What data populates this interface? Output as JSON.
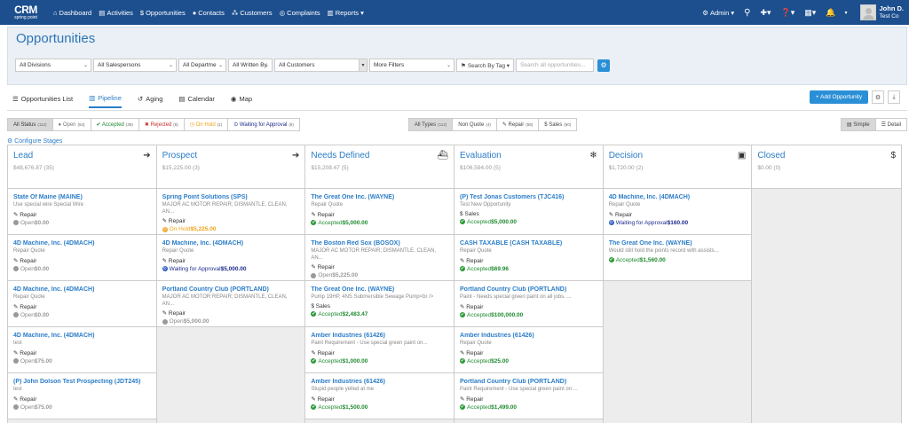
{
  "nav": {
    "logo_big": "CRM",
    "logo_small": "spring point",
    "items": [
      {
        "icon": "home-icon",
        "glyph": "⌂",
        "label": "Dashboard"
      },
      {
        "icon": "calendar-icon",
        "glyph": "▤",
        "label": "Activities"
      },
      {
        "icon": "dollar-icon",
        "glyph": "$",
        "label": "Opportunities"
      },
      {
        "icon": "user-icon",
        "glyph": "●",
        "label": "Contacts"
      },
      {
        "icon": "users-icon",
        "glyph": "⁂",
        "label": "Customers"
      },
      {
        "icon": "help-icon",
        "glyph": "◎",
        "label": "Complaints"
      },
      {
        "icon": "chart-icon",
        "glyph": "▥",
        "label": "Reports ▾"
      }
    ],
    "admin_label": "Admin ▾",
    "user_name": "John D.",
    "user_company": "Test Co"
  },
  "page": {
    "title": "Opportunities"
  },
  "filters": {
    "divisions": "All Divisions",
    "salespersons": "All Salespersons",
    "departments": "All Departme",
    "written_by": "All Written By",
    "customers": "All Customers",
    "more": "More Filters",
    "search_by_tag": "Search By Tag ▾",
    "search_placeholder": "Search all opportunities..."
  },
  "tabs": [
    {
      "icon": "list-icon",
      "glyph": "☰",
      "label": "Opportunities List"
    },
    {
      "icon": "bar-chart-icon",
      "glyph": "▥",
      "label": "Pipeline"
    },
    {
      "icon": "history-icon",
      "glyph": "↺",
      "label": "Aging"
    },
    {
      "icon": "calendar-icon",
      "glyph": "▤",
      "label": "Calendar"
    },
    {
      "icon": "globe-icon",
      "glyph": "◉",
      "label": "Map"
    }
  ],
  "add_opportunity_label": "+ Add Opportunity",
  "status_filters": [
    {
      "label": "All Status",
      "count": "(112)"
    },
    {
      "label": "● Open",
      "count": "(64)"
    },
    {
      "label": "✔ Accepted",
      "count": "(39)"
    },
    {
      "label": "✖ Rejected",
      "count": "(8)"
    },
    {
      "label": "◷ On Hold",
      "count": "(1)"
    },
    {
      "label": "⊙ Waiting for Approval",
      "count": "(8)"
    }
  ],
  "type_filters": [
    {
      "label": "All Types",
      "count": "(112)"
    },
    {
      "label": "Non Quote",
      "count": "(4)"
    },
    {
      "label": "✎ Repair",
      "count": "(58)"
    },
    {
      "label": "$ Sales",
      "count": "(50)"
    }
  ],
  "view_simple": "▤ Simple",
  "view_detail": "☰ Detail",
  "configure_stages": "⚙ Configure Stages",
  "columns": [
    {
      "name": "Lead",
      "amount": "$48,676.87 (35)",
      "icon": "arrow-right-icon",
      "glyph": "➔",
      "cards": [
        {
          "title": "State Of Maine (MAINE)",
          "desc": "Use special wire Special Wire",
          "type": "✎ Repair",
          "status": "Open",
          "value": "$0.00"
        },
        {
          "title": "4D Machine, Inc. (4DMACH)",
          "desc": "Repair Quote",
          "type": "✎ Repair",
          "status": "Open",
          "value": "$0.00"
        },
        {
          "title": "4D Machine, Inc. (4DMACH)",
          "desc": "Repair Quote",
          "type": "✎ Repair",
          "status": "Open",
          "value": "$0.00"
        },
        {
          "title": "4D Machine, Inc. (4DMACH)",
          "desc": "test",
          "type": "✎ Repair",
          "status": "Open",
          "value": "$75.00"
        },
        {
          "title": "(P) John Dolson Test Prospecting (JDT245)",
          "desc": "test",
          "type": "✎ Repair",
          "status": "Open",
          "value": "$75.00"
        }
      ]
    },
    {
      "name": "Prospect",
      "amount": "$15,225.00 (3)",
      "icon": "arrow-right-icon",
      "glyph": "➔",
      "cards": [
        {
          "title": "Spring Point Solutions (SPS)",
          "desc": "MAJOR AC MOTOR REPAIR; DISMANTLE, CLEAN, AN...",
          "type": "✎ Repair",
          "status": "On Hold",
          "value": "$5,225.00"
        },
        {
          "title": "4D Machine, Inc. (4DMACH)",
          "desc": "Repair Quote",
          "type": "✎ Repair",
          "status": "Waiting for Approval",
          "value": "$5,000.00"
        },
        {
          "title": "Portland Country Club (PORTLAND)",
          "desc": "MAJOR AC MOTOR REPAIR; DISMANTLE, CLEAN, AN...",
          "type": "✎ Repair",
          "status": "Open",
          "value": "$5,000.00"
        }
      ]
    },
    {
      "name": "Needs Defined",
      "amount": "$15,208.47 (5)",
      "icon": "ship-icon",
      "glyph": "⛴",
      "cards": [
        {
          "title": "The Great One Inc. (WAYNE)",
          "desc": "Repair Quote",
          "type": "✎ Repair",
          "status": "Accepted",
          "value": "$5,000.00"
        },
        {
          "title": "The Boston Red Sox (BOSOX)",
          "desc": "MAJOR AC MOTOR REPAIR; DISMANTLE, CLEAN, AN...",
          "type": "✎ Repair",
          "status": "Open",
          "value": "$5,225.00"
        },
        {
          "title": "The Great One Inc. (WAYNE)",
          "desc": "Pump 19HP, 4NS Submersible Sewage Pump<br />",
          "type": "$ Sales",
          "status": "Accepted",
          "value": "$2,483.47"
        },
        {
          "title": "Amber Industries (61426)",
          "desc": "Paint Requirement - Use special green paint on...",
          "type": "✎ Repair",
          "status": "Accepted",
          "value": "$1,000.00"
        },
        {
          "title": "Amber Industries (61426)",
          "desc": "Stupid people yelled at me",
          "type": "✎ Repair",
          "status": "Accepted",
          "value": "$1,500.00"
        }
      ]
    },
    {
      "name": "Evaluation",
      "amount": "$106,594.00 (5)",
      "icon": "snowflake-icon",
      "glyph": "❄",
      "cards": [
        {
          "title": "(P) Test Jonas Customers (TJC416)",
          "desc": "Test New Opportunity",
          "type": "$ Sales",
          "status": "Accepted",
          "value": "$5,000.00"
        },
        {
          "title": "CASH TAXABLE (CASH TAXABLE)",
          "desc": "Repair Quote",
          "type": "✎ Repair",
          "status": "Accepted",
          "value": "$69.96"
        },
        {
          "title": "Portland Country Club (PORTLAND)",
          "desc": "Paint - Needs special green paint on all jobs. ...",
          "type": "✎ Repair",
          "status": "Accepted",
          "value": "$100,000.00"
        },
        {
          "title": "Amber Industries (61426)",
          "desc": "Repair Quote",
          "type": "✎ Repair",
          "status": "Accepted",
          "value": "$25.00"
        },
        {
          "title": "Portland Country Club (PORTLAND)",
          "desc": "Paint Requirement - Use special green paint on ...",
          "type": "✎ Repair",
          "status": "Accepted",
          "value": "$1,499.00"
        }
      ]
    },
    {
      "name": "Decision",
      "amount": "$1,720.00 (2)",
      "icon": "money-icon",
      "glyph": "▣",
      "cards": [
        {
          "title": "4D Machine, Inc. (4DMACH)",
          "desc": "Repair Quote",
          "type": "✎ Repair",
          "status": "Waiting for Approval",
          "value": "$160.00"
        },
        {
          "title": "The Great One Inc. (WAYNE)",
          "desc": "Would still hold the points record with assists...",
          "type": "",
          "status": "Accepted",
          "value": "$1,560.00"
        }
      ]
    },
    {
      "name": "Closed",
      "amount": "$0.00 (0)",
      "icon": "dollar-icon",
      "glyph": "$",
      "cards": []
    }
  ],
  "colors": {
    "navbar": "#1d4f8e",
    "accent": "#2b7dc8",
    "accepted": "#1e8a2f",
    "on_hold": "#f0a21a",
    "waiting": "#1b2a8a"
  }
}
